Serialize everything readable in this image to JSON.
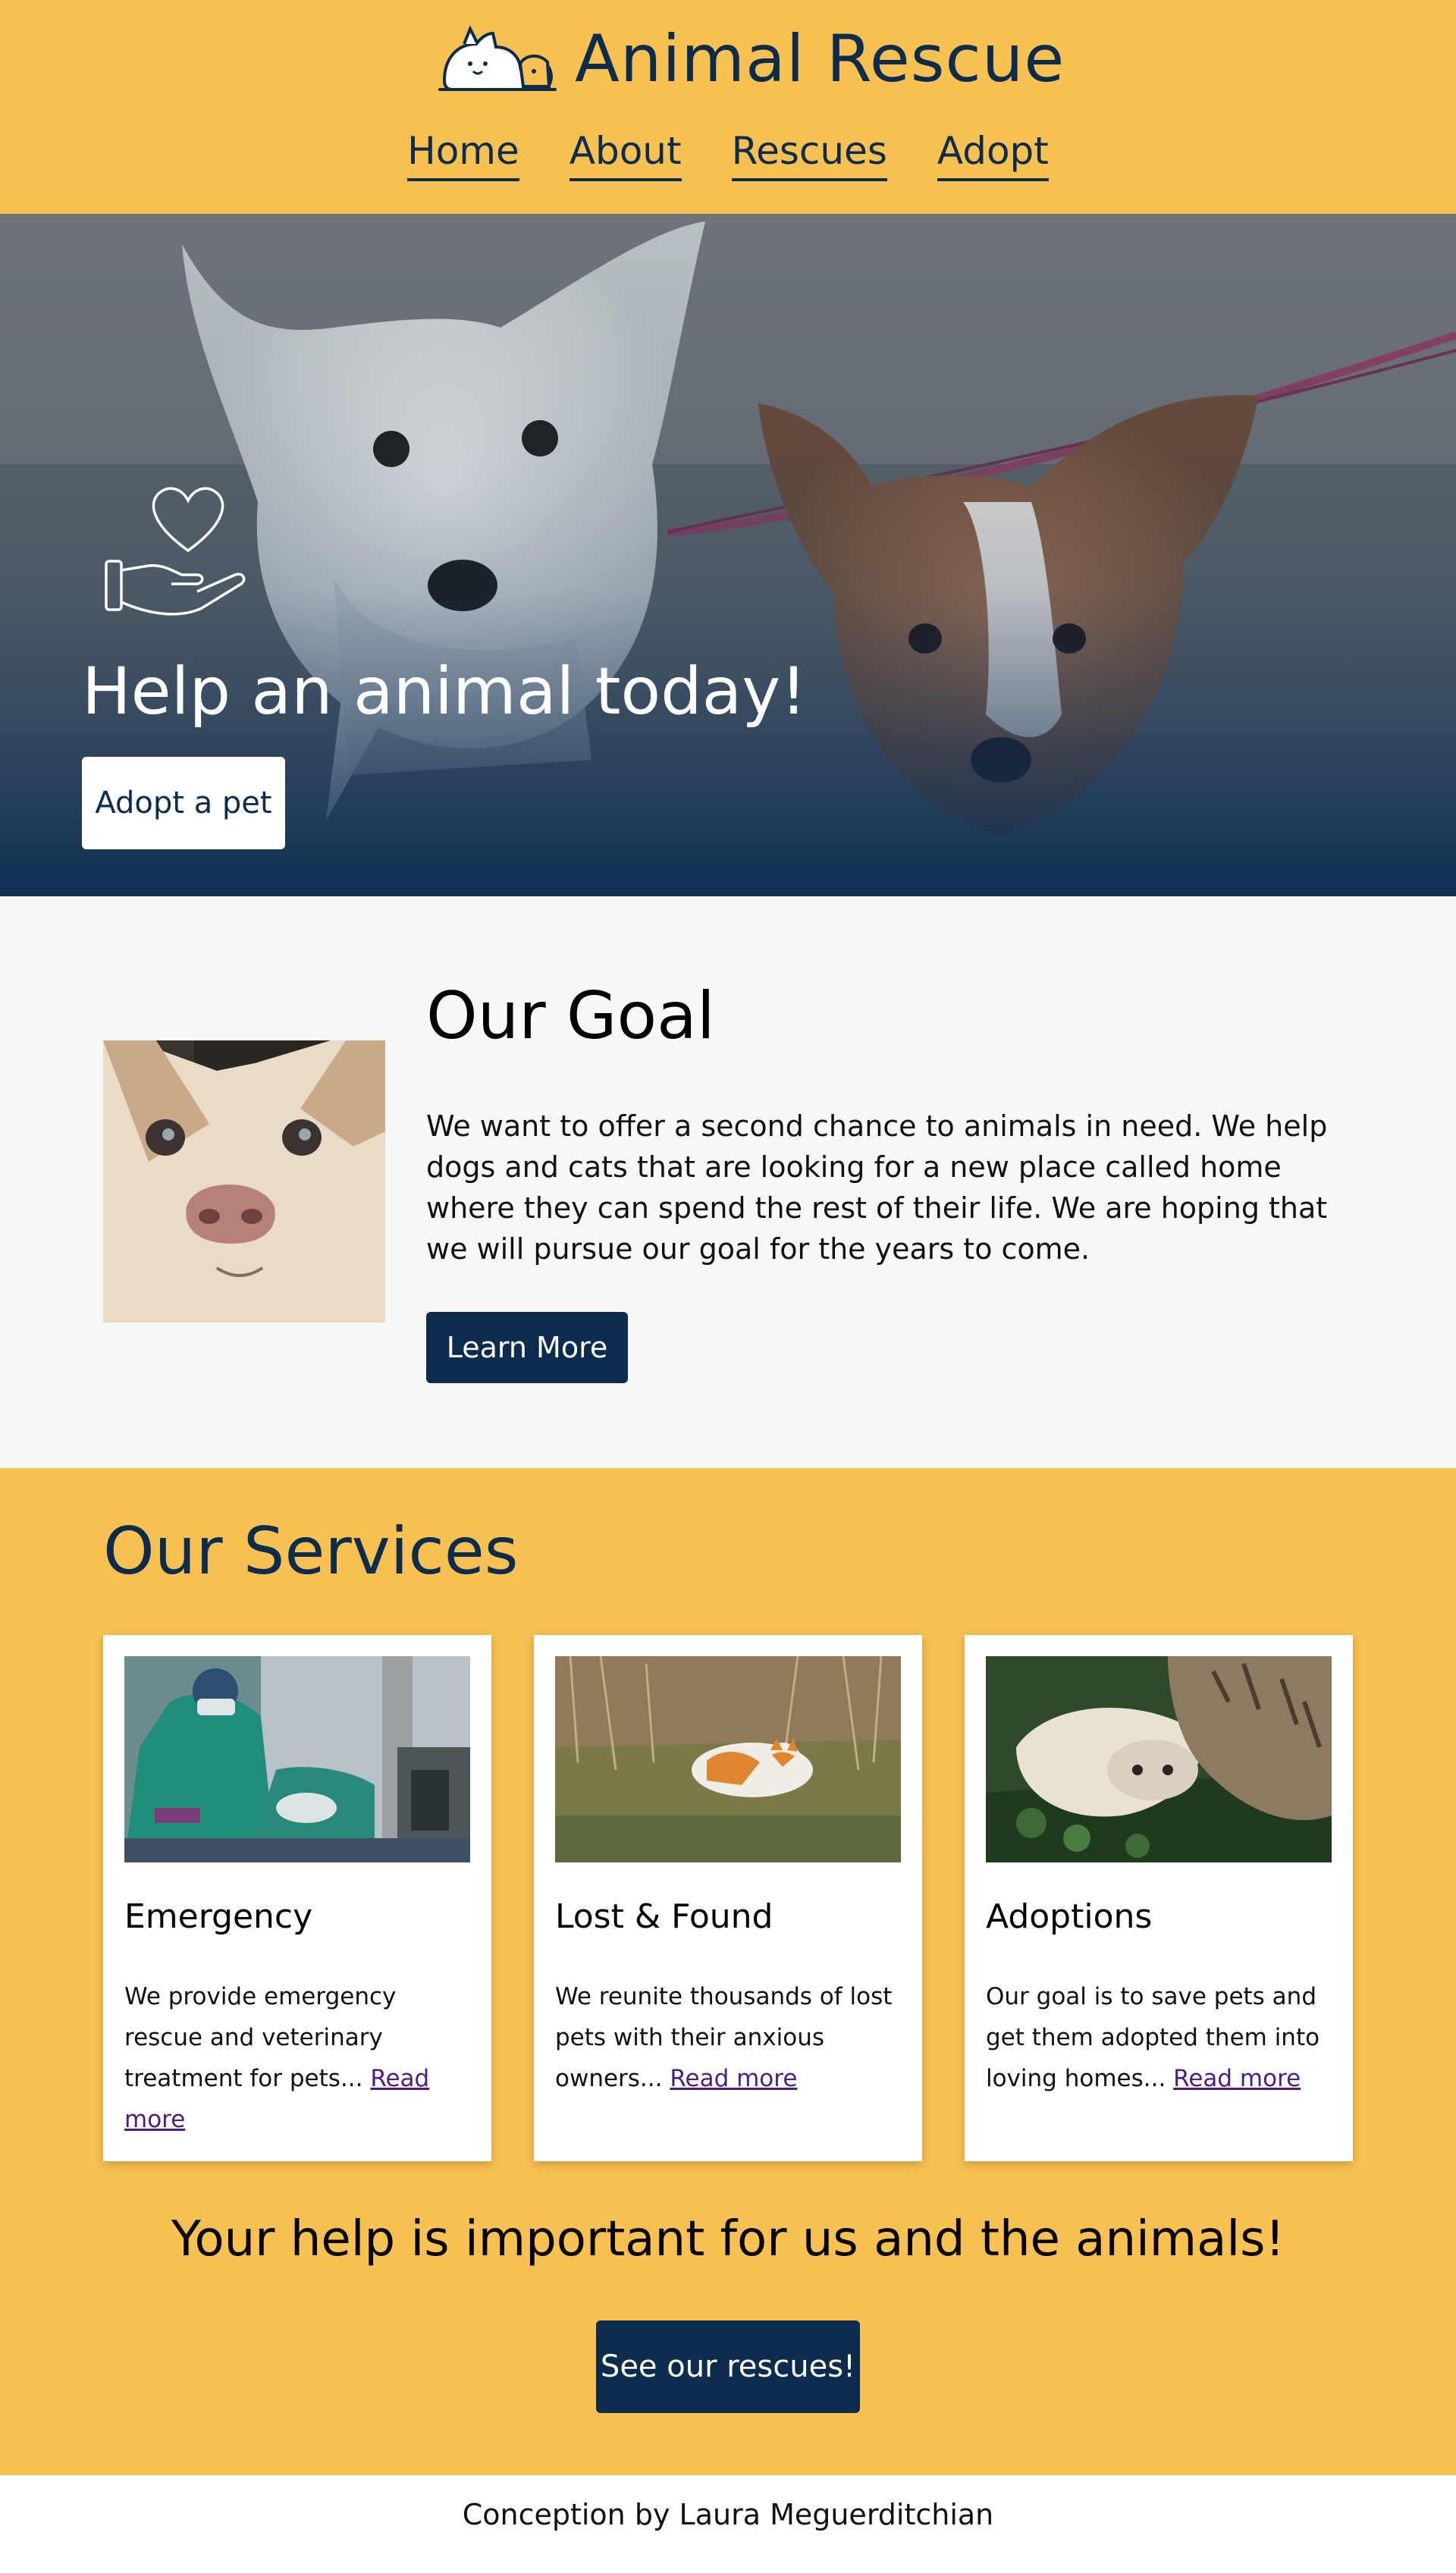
{
  "header": {
    "brand_title": "Animal Rescue",
    "logo_icon": "cat-and-dog-logo-icon",
    "nav": [
      {
        "label": "Home"
      },
      {
        "label": "About"
      },
      {
        "label": "Rescues"
      },
      {
        "label": "Adopt"
      }
    ]
  },
  "hero": {
    "icon": "hand-holding-heart-icon",
    "title": "Help an animal today!",
    "button_label": "Adopt a pet"
  },
  "goal": {
    "title": "Our Goal",
    "text": "We want to offer a second chance to animals in need. We help dogs and cats that are looking for a new place called home where they can spend the rest of their life. We are hoping that we will pursue our goal for the years to come.",
    "button_label": "Learn More"
  },
  "services": {
    "title": "Our Services",
    "cards": [
      {
        "title": "Emergency",
        "text": "We provide emergency rescue and veterinary treatment for pets... ",
        "link": "Read more"
      },
      {
        "title": "Lost & Found",
        "text": "We reunite thousands of lost pets with their anxious owners... ",
        "link": "Read more"
      },
      {
        "title": "Adoptions",
        "text": "Our goal is to save pets and get them adopted them into loving homes... ",
        "link": "Read more"
      }
    ],
    "cta_text": "Your help is important for us and the animals!",
    "cta_button": "See our rescues!"
  },
  "footer": {
    "text": "Conception by Laura Meguerditchian"
  },
  "colors": {
    "accent_yellow": "#f9c052",
    "navy": "#0b2c4c",
    "link_purple": "#4b1f7a"
  }
}
